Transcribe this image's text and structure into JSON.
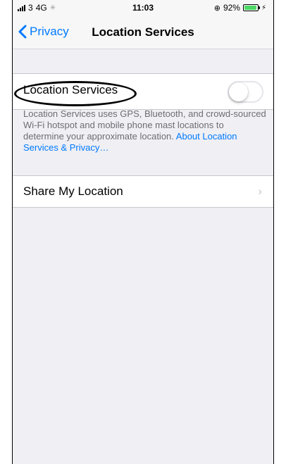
{
  "status_bar": {
    "carrier": "3",
    "network": "4G",
    "time": "11:03",
    "battery_text": "92%",
    "battery_level": 0.92,
    "battery_color": "#4cd964"
  },
  "nav": {
    "back_label": "Privacy",
    "title": "Location Services"
  },
  "location_services": {
    "label": "Location Services",
    "enabled": false,
    "footer_text": "Location Services uses GPS, Bluetooth, and crowd-sourced Wi-Fi hotspot and mobile phone mast locations to determine your approximate location.",
    "footer_link": "About Location Services & Privacy…"
  },
  "share_location": {
    "label": "Share My Location"
  },
  "colors": {
    "accent": "#007aff",
    "background": "#efeff4"
  },
  "icons": [
    "signal-icon",
    "activity-icon",
    "orientation-lock-icon",
    "battery-icon",
    "charging-icon",
    "chevron-left-icon",
    "chevron-right-icon"
  ]
}
